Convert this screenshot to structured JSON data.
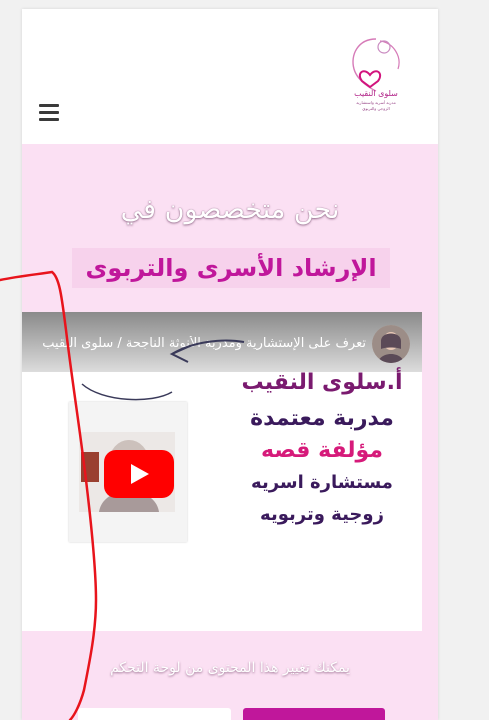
{
  "header": {
    "logo_text_main": "سلوى النقيب",
    "logo_text_sub1": "مدربة أسرية واستشارية",
    "logo_text_sub2": "الزوجي والتربوي",
    "menu_icon": "hamburger-menu-icon"
  },
  "hero": {
    "heading1": "نحن متخصصون في",
    "heading2": "الإرشاد الأسرى والتربوى"
  },
  "video": {
    "title": "تعرف على الإستشارية ومدربة الأنوثة الناجحة / سلوى النقيب",
    "thumbnail_name": "أ.سلوى النقيب",
    "line1": "مدربة معتمدة",
    "line2": "مؤلفة قصه",
    "line3": "مستشارة اسريه",
    "line4": "زوجية وتربويه",
    "play_icon": "youtube-play-icon"
  },
  "caption": "يمكنك تغيير هذا المحتوى من لوحة التحكم",
  "colors": {
    "accent": "#c0179b",
    "page_bg": "#fbe0f3",
    "annotation": "#ff0000"
  }
}
